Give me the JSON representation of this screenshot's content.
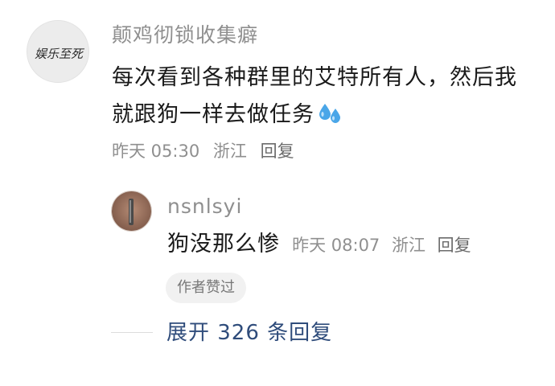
{
  "comment": {
    "username": "颠鸡彻锁收集癖",
    "avatar_text": "娱乐至死",
    "text_line1": "每次看到各种群里的艾特所有人，然后我",
    "text_line2": "就跟狗一样去做任务",
    "time": "昨天 05:30",
    "location": "浙江",
    "reply_label": "回复"
  },
  "reply": {
    "username": "nsnlsyi",
    "text": "狗没那么惨",
    "time": "昨天 08:07",
    "location": "浙江",
    "reply_label": "回复",
    "badge": "作者赞过"
  },
  "expand": {
    "label": "展开 326 条回复"
  },
  "colors": {
    "meta_gray": "#8f8f8f",
    "link_blue": "#2f4c7b",
    "sweat_blue": "#4aa6e8"
  },
  "icons": {
    "sweat": "sweat-droplets-icon"
  }
}
